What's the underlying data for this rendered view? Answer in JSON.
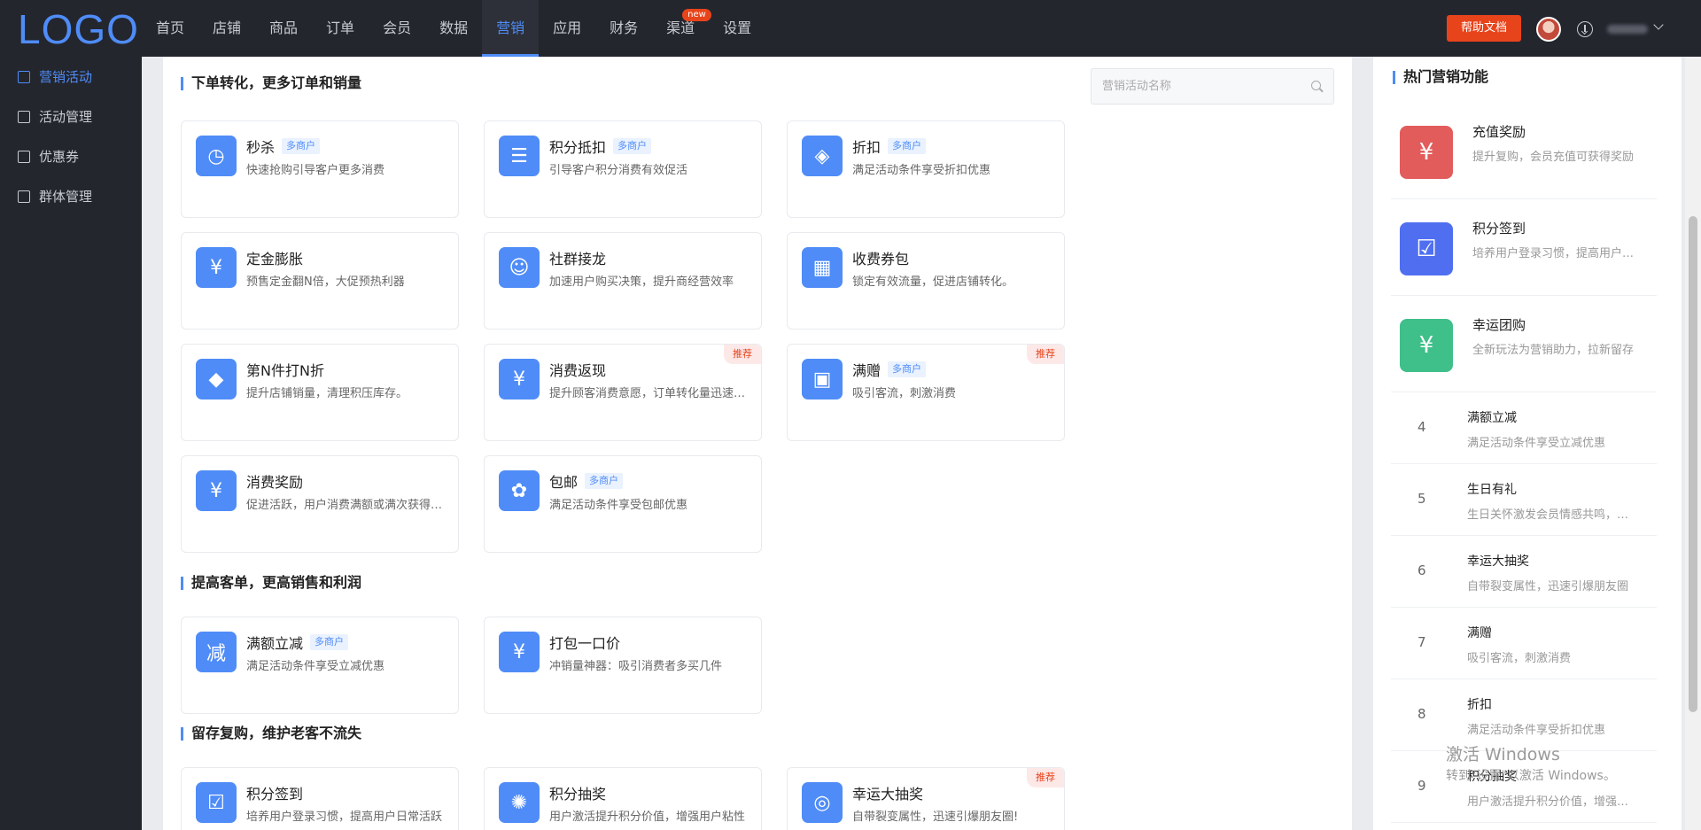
{
  "logo": "LOGO",
  "nav": [
    {
      "label": "首页"
    },
    {
      "label": "店铺"
    },
    {
      "label": "商品"
    },
    {
      "label": "订单"
    },
    {
      "label": "会员"
    },
    {
      "label": "数据"
    },
    {
      "label": "营销",
      "active": true
    },
    {
      "label": "应用"
    },
    {
      "label": "财务"
    },
    {
      "label": "渠道",
      "badge": "new"
    },
    {
      "label": "设置"
    }
  ],
  "header": {
    "help_label": "帮助文档"
  },
  "sidebar": {
    "items": [
      {
        "label": "营销活动",
        "active": true
      },
      {
        "label": "活动管理"
      },
      {
        "label": "优惠券"
      },
      {
        "label": "群体管理"
      }
    ]
  },
  "search": {
    "placeholder": "营销活动名称"
  },
  "tags": {
    "multi": "多商户",
    "recommend": "推荐"
  },
  "sections": [
    {
      "title": "下单转化，更多订单和销量",
      "cards": [
        {
          "title": "秒杀",
          "desc": "快速抢购引导客户更多消费",
          "multi": true,
          "icon": "alarm-clock-icon"
        },
        {
          "title": "积分抵扣",
          "desc": "引导客户积分消费有效促活",
          "multi": true,
          "icon": "coin-stack-icon"
        },
        {
          "title": "折扣",
          "desc": "满足活动条件享受折扣优惠",
          "multi": true,
          "icon": "discount-tag-icon"
        },
        {
          "title": "定金膨胀",
          "desc": "预售定金翻N倍，大促预热利器",
          "icon": "deposit-clock-icon"
        },
        {
          "title": "社群接龙",
          "desc": "加速用户购买决策，提升商经营效率",
          "icon": "group-users-icon"
        },
        {
          "title": "收费券包",
          "desc": "锁定有效流量，促进店铺转化。",
          "icon": "coupon-pack-icon"
        },
        {
          "title": "第N件打N折",
          "desc": "提升店铺销量，清理积压库存。",
          "icon": "price-tag-icon"
        },
        {
          "title": "消费返现",
          "desc": "提升顾客消费意愿，订单转化量迅速提升",
          "recommend": true,
          "icon": "cashback-icon"
        },
        {
          "title": "满赠",
          "desc": "吸引客流，刺激消费",
          "multi": true,
          "recommend": true,
          "icon": "gift-icon"
        },
        {
          "title": "消费奖励",
          "desc": "促进活跃，用户消费满额或满次获得奖励",
          "icon": "receipt-icon"
        },
        {
          "title": "包邮",
          "desc": "满足活动条件享受包邮优惠",
          "multi": true,
          "icon": "free-shipping-icon"
        }
      ]
    },
    {
      "title": "提高客单，更高销售和利润",
      "cards": [
        {
          "title": "满额立减",
          "desc": "满足活动条件享受立减优惠",
          "multi": true,
          "icon": "reduce-icon"
        },
        {
          "title": "打包一口价",
          "desc": "冲销量神器：吸引消费者多买几件",
          "icon": "package-price-icon"
        }
      ]
    },
    {
      "title": "留存复购，维护老客不流失",
      "cards": [
        {
          "title": "积分签到",
          "desc": "培养用户登录习惯，提高用户日常活跃",
          "icon": "calendar-check-icon"
        },
        {
          "title": "积分抽奖",
          "desc": "用户激活提升积分价值，增强用户粘性",
          "icon": "lottery-wheel-icon"
        },
        {
          "title": "幸运大抽奖",
          "desc": "自带裂变属性，迅速引爆朋友圈!",
          "recommend": true,
          "icon": "lucky-draw-icon"
        }
      ]
    }
  ],
  "hot": {
    "title": "热门营销功能",
    "top": [
      {
        "title": "充值奖励",
        "desc": "提升复购，会员充值可获得奖励",
        "color": "#e25c5c",
        "icon": "recharge-icon"
      },
      {
        "title": "积分签到",
        "desc": "培养用户登录习惯，提高用户日常活跃",
        "color": "#4f6ff0",
        "icon": "calendar-check-icon"
      },
      {
        "title": "幸运团购",
        "desc": "全新玩法为营销助力，拉新留存",
        "color": "#3fbf8a",
        "icon": "group-buy-icon"
      }
    ],
    "list": [
      {
        "rank": "4",
        "title": "满额立减",
        "desc": "满足活动条件享受立减优惠"
      },
      {
        "rank": "5",
        "title": "生日有礼",
        "desc": "生日关怀激发会员情感共鸣，提升复购"
      },
      {
        "rank": "6",
        "title": "幸运大抽奖",
        "desc": "自带裂变属性，迅速引爆朋友圈"
      },
      {
        "rank": "7",
        "title": "满赠",
        "desc": "吸引客流，刺激消费"
      },
      {
        "rank": "8",
        "title": "折扣",
        "desc": "满足活动条件享受折扣优惠"
      },
      {
        "rank": "9",
        "title": "积分抽奖",
        "desc": "用户激活提升积分价值，增强用户粘性"
      }
    ]
  },
  "watermark": {
    "line1": "激活 Windows",
    "line2": "转到\"设置\"以激活 Windows。"
  },
  "colors": {
    "accent": "#4f8cf7",
    "danger": "#e8441b",
    "dark": "#24262e"
  }
}
